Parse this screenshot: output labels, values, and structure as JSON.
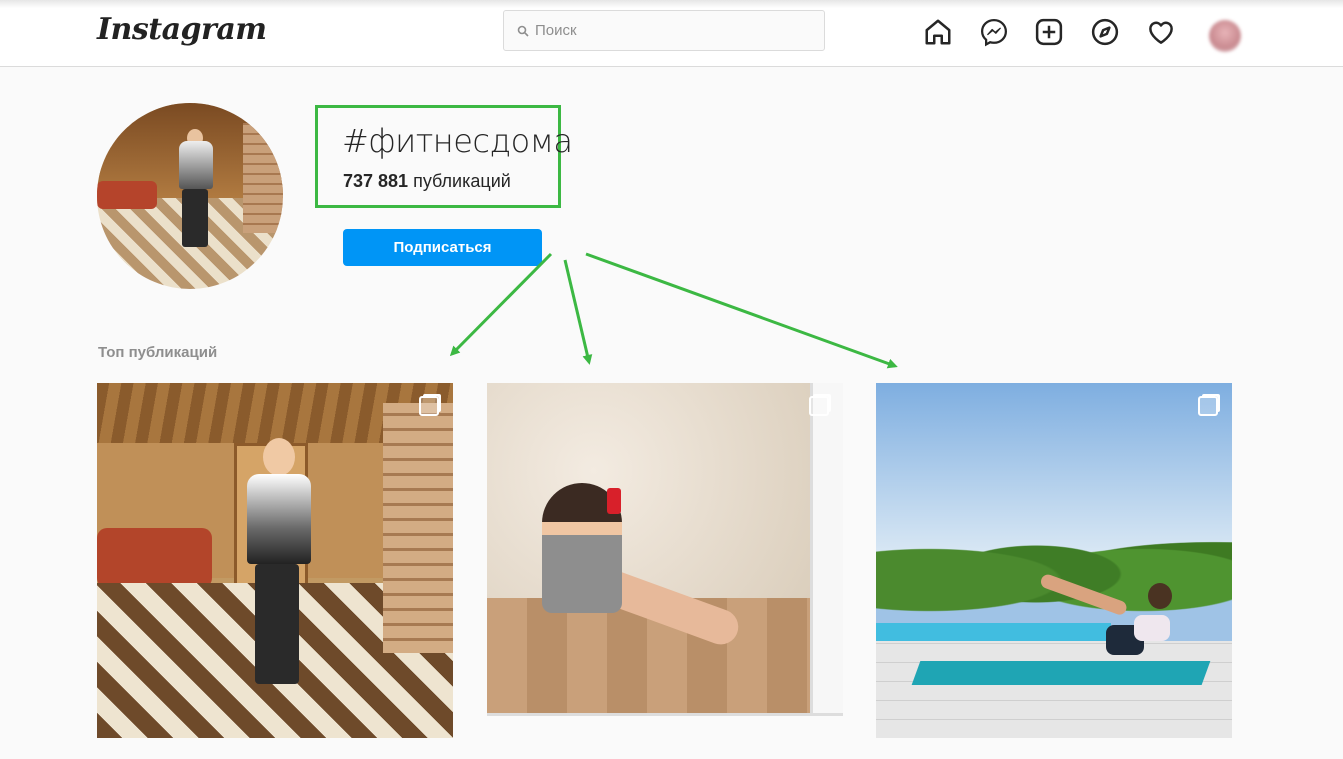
{
  "header": {
    "logo": "Instagram",
    "search_placeholder": "Поиск",
    "icons": [
      "home-icon",
      "messenger-icon",
      "new-post-icon",
      "explore-icon",
      "activity-heart-icon",
      "profile-avatar"
    ]
  },
  "hashtag": {
    "name": "#фитнесдома",
    "posts_count": "737 881",
    "posts_label": "публикаций",
    "follow_label": "Подписаться"
  },
  "top_posts": {
    "title": "Топ публикаций",
    "posts": [
      {
        "kind": "carousel"
      },
      {
        "kind": "carousel"
      },
      {
        "kind": "carousel"
      }
    ]
  },
  "colors": {
    "accent": "#0095f6",
    "highlight": "#3cb843"
  }
}
